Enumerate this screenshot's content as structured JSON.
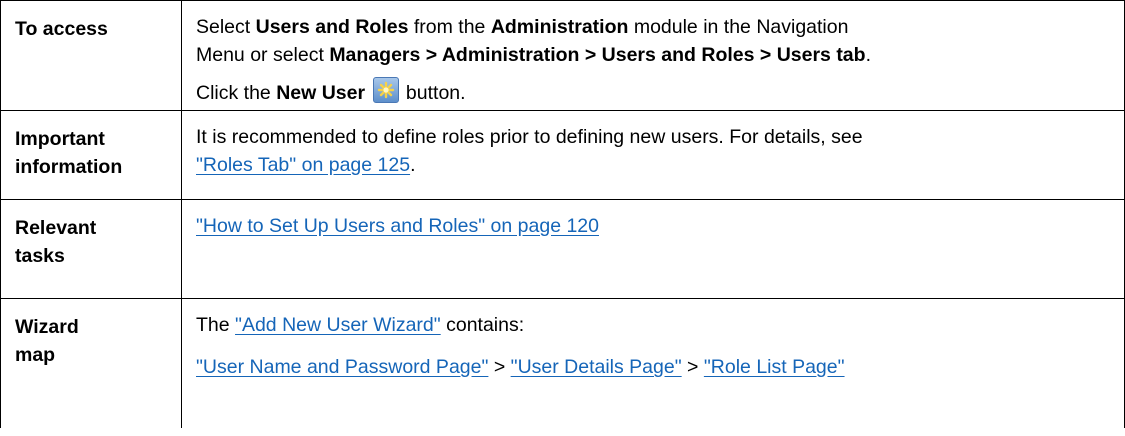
{
  "rows": [
    {
      "label_lines": [
        "To access"
      ],
      "sentence1": {
        "t1": "Select ",
        "b1": "Users and Roles",
        "t2": " from the ",
        "b2": "Administration",
        "t3": " module in the Navigation",
        "t4": "Menu or select ",
        "b3": "Managers > Administration > Users and Roles > Users tab",
        "t5": "."
      },
      "sentence2": {
        "t1": "Click the ",
        "b1": "New User",
        "t2": " button.",
        "icon": "new-user-icon"
      }
    },
    {
      "label_lines": [
        "Important",
        "information"
      ],
      "text_line1": "It is recommended to define roles prior to defining new users. For details, see",
      "link": "\"Roles Tab\" on page 125",
      "text_end": "."
    },
    {
      "label_lines": [
        "Relevant",
        "tasks"
      ],
      "link": "\"How to Set Up Users and Roles\" on page 120"
    },
    {
      "label_lines": [
        "Wizard",
        "map"
      ],
      "line1": {
        "t1": "The ",
        "link": "\"Add New User Wizard\"",
        "t2": " contains:"
      },
      "line2": {
        "link1": "\"User Name and Password Page\"",
        "sep1": " > ",
        "link2": "\"User Details Page\"",
        "sep2": " > ",
        "link3": "\"Role List Page\""
      }
    }
  ],
  "colors": {
    "link": "#1565b8",
    "border": "#000000",
    "icon_star": "#f6d24a"
  }
}
